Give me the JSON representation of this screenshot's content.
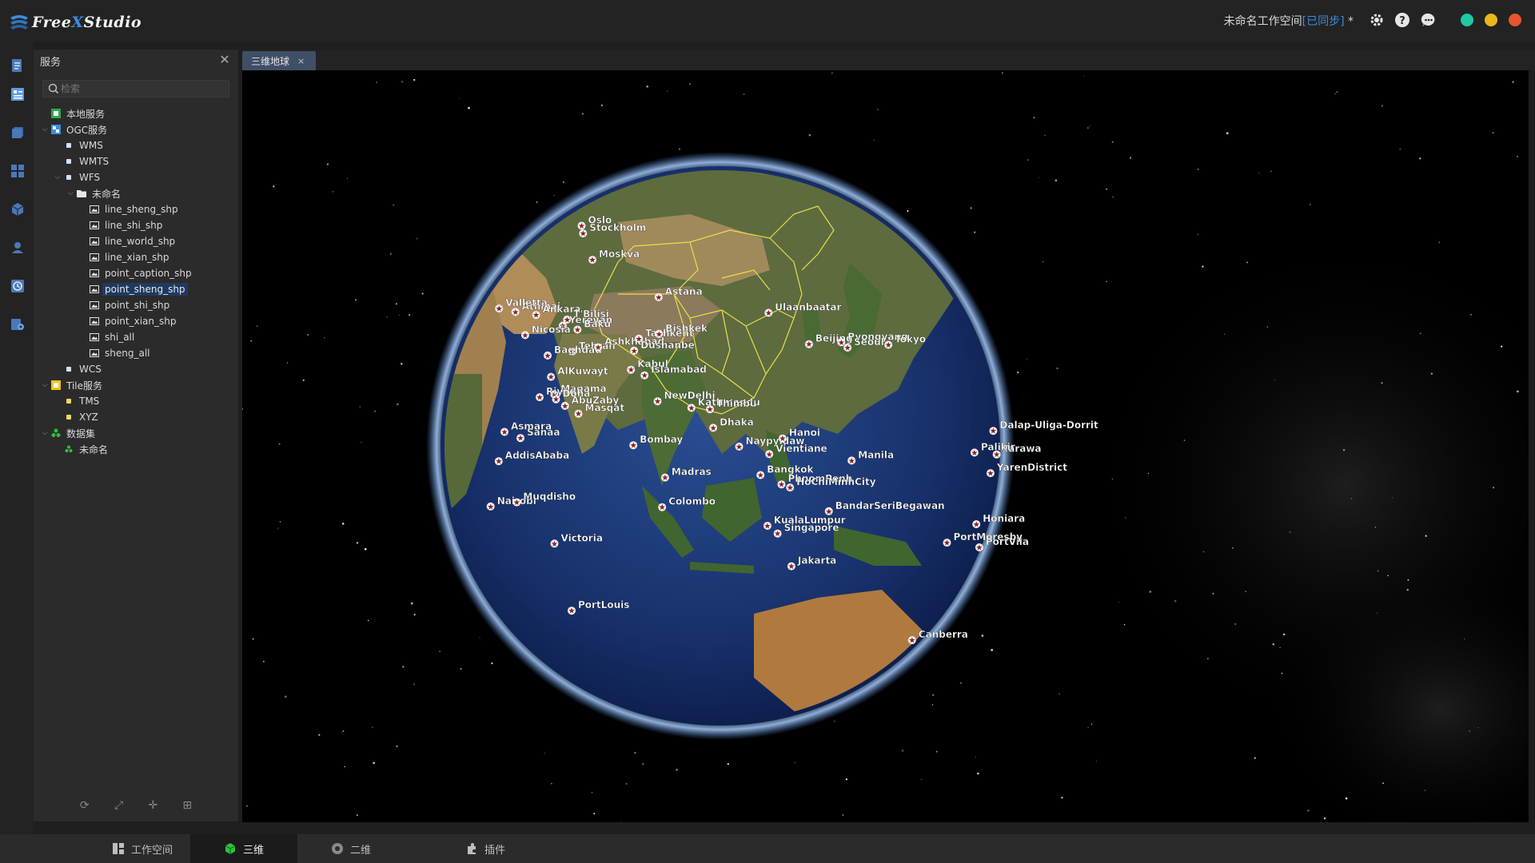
{
  "app": {
    "logo_text_1": "Free",
    "logo_text_x": "X",
    "logo_text_2": "Studio"
  },
  "header": {
    "workspace_name": "未命名工作空间",
    "sync_status": "[已同步]",
    "unsaved_mark": "*"
  },
  "panel": {
    "title": "服务",
    "search_placeholder": "检索",
    "tree": [
      {
        "label": "本地服务",
        "depth": 0,
        "caret": "",
        "icon": "local-service-icon"
      },
      {
        "label": "OGC服务",
        "depth": 0,
        "caret": "open",
        "icon": "ogc-service-icon"
      },
      {
        "label": "WMS",
        "depth": 1,
        "caret": "",
        "icon": "service-dot-icon"
      },
      {
        "label": "WMTS",
        "depth": 1,
        "caret": "",
        "icon": "service-dot-icon"
      },
      {
        "label": "WFS",
        "depth": 1,
        "caret": "open",
        "icon": "service-dot-icon"
      },
      {
        "label": "未命名",
        "depth": 2,
        "caret": "open",
        "icon": "folder-icon"
      },
      {
        "label": "line_sheng_shp",
        "depth": 3,
        "caret": "",
        "icon": "layer-icon"
      },
      {
        "label": "line_shi_shp",
        "depth": 3,
        "caret": "",
        "icon": "layer-icon"
      },
      {
        "label": "line_world_shp",
        "depth": 3,
        "caret": "",
        "icon": "layer-icon"
      },
      {
        "label": "line_xian_shp",
        "depth": 3,
        "caret": "",
        "icon": "layer-icon"
      },
      {
        "label": "point_caption_shp",
        "depth": 3,
        "caret": "",
        "icon": "layer-icon"
      },
      {
        "label": "point_sheng_shp",
        "depth": 3,
        "caret": "",
        "icon": "layer-icon",
        "selected": true
      },
      {
        "label": "point_shi_shp",
        "depth": 3,
        "caret": "",
        "icon": "layer-icon"
      },
      {
        "label": "point_xian_shp",
        "depth": 3,
        "caret": "",
        "icon": "layer-icon"
      },
      {
        "label": "shi_all",
        "depth": 3,
        "caret": "",
        "icon": "layer-icon"
      },
      {
        "label": "sheng_all",
        "depth": 3,
        "caret": "",
        "icon": "layer-icon"
      },
      {
        "label": "WCS",
        "depth": 1,
        "caret": "",
        "icon": "service-dot-icon"
      },
      {
        "label": "Tile服务",
        "depth": 0,
        "caret": "open",
        "icon": "tile-service-icon"
      },
      {
        "label": "TMS",
        "depth": 1,
        "caret": "",
        "icon": "tile-dot-icon"
      },
      {
        "label": "XYZ",
        "depth": 1,
        "caret": "",
        "icon": "tile-dot-icon"
      },
      {
        "label": "数据集",
        "depth": 0,
        "caret": "open",
        "icon": "dataset-icon"
      },
      {
        "label": "未命名",
        "depth": 1,
        "caret": "",
        "icon": "dataset-item-icon"
      }
    ]
  },
  "tabs": [
    {
      "label": "三维地球",
      "close": "×"
    }
  ],
  "bottom_tabs": [
    {
      "label": "工作空间",
      "icon": "workspace-icon"
    },
    {
      "label": "三维",
      "icon": "cube-icon",
      "active": true
    },
    {
      "label": "二维",
      "icon": "globe-2d-icon"
    },
    {
      "label": "插件",
      "icon": "plugin-icon"
    }
  ],
  "colors": {
    "accent": "#3b8de0",
    "selected_bg": "#1e3a62",
    "win_green": "#1fc9a0",
    "win_yellow": "#e8b81a",
    "win_red": "#e8542f",
    "marker": "#8b1c24"
  },
  "globe": {
    "labels": [
      {
        "text": "Oslo",
        "lon": 10.7,
        "lat": 59.9
      },
      {
        "text": "Stockholm",
        "lon": 18.1,
        "lat": 59.3
      },
      {
        "text": "Moskva",
        "lon": 37.6,
        "lat": 55.8
      },
      {
        "text": "Athinai",
        "lon": 23.7,
        "lat": 38.0
      },
      {
        "text": "Valletta",
        "lon": 14.5,
        "lat": 35.9
      },
      {
        "text": "Ankara",
        "lon": 32.9,
        "lat": 39.9
      },
      {
        "text": "T'Bilisi",
        "lon": 44.8,
        "lat": 41.7
      },
      {
        "text": "Yerevan",
        "lon": 44.5,
        "lat": 40.2
      },
      {
        "text": "Nicosia",
        "lon": 33.4,
        "lat": 35.2
      },
      {
        "text": "Baku",
        "lon": 49.9,
        "lat": 40.4
      },
      {
        "text": "Tehran",
        "lon": 51.4,
        "lat": 35.7
      },
      {
        "text": "Astana",
        "lon": 71.4,
        "lat": 51.2
      },
      {
        "text": "Baghdad",
        "lon": 44.4,
        "lat": 33.3
      },
      {
        "text": "Ashkhabad",
        "lon": 58.4,
        "lat": 37.9
      },
      {
        "text": "Tashkent",
        "lon": 69.2,
        "lat": 41.3
      },
      {
        "text": "Bishkek",
        "lon": 74.6,
        "lat": 42.9
      },
      {
        "text": "Dushanbe",
        "lon": 68.8,
        "lat": 38.6
      },
      {
        "text": "Ulaanbaatar",
        "lon": 106.9,
        "lat": 47.9
      },
      {
        "text": "AlKuwayt",
        "lon": 48.0,
        "lat": 29.4
      },
      {
        "text": "Kabul",
        "lon": 69.2,
        "lat": 34.5
      },
      {
        "text": "Manama",
        "lon": 50.6,
        "lat": 26.2
      },
      {
        "text": "Riyadh",
        "lon": 46.7,
        "lat": 24.7
      },
      {
        "text": "Doha",
        "lon": 51.5,
        "lat": 25.3
      },
      {
        "text": "Islamabad",
        "lon": 73.0,
        "lat": 33.7
      },
      {
        "text": "Beijing",
        "lon": 116.4,
        "lat": 39.9
      },
      {
        "text": "Pyongyang",
        "lon": 125.8,
        "lat": 39.0
      },
      {
        "text": "Seoul",
        "lon": 127.0,
        "lat": 37.6
      },
      {
        "text": "Tokyo",
        "lon": 139.7,
        "lat": 35.7
      },
      {
        "text": "Asmara",
        "lon": 38.9,
        "lat": 15.3
      },
      {
        "text": "AbuZaby",
        "lon": 54.4,
        "lat": 24.5
      },
      {
        "text": "Masqat",
        "lon": 58.4,
        "lat": 23.6
      },
      {
        "text": "Sanaa",
        "lon": 44.2,
        "lat": 15.4
      },
      {
        "text": "AddisAbaba",
        "lon": 38.7,
        "lat": 9.0
      },
      {
        "text": "NewDelhi",
        "lon": 77.2,
        "lat": 28.6
      },
      {
        "text": "Kathmandu",
        "lon": 85.3,
        "lat": 27.7
      },
      {
        "text": "Thimbu",
        "lon": 89.6,
        "lat": 27.5
      },
      {
        "text": "Dhaka",
        "lon": 90.4,
        "lat": 23.7
      },
      {
        "text": "Nairobi",
        "lon": 36.8,
        "lat": -1.3
      },
      {
        "text": "Muqdisho",
        "lon": 45.3,
        "lat": 2.0
      },
      {
        "text": "Bombay",
        "lon": 72.8,
        "lat": 19.1
      },
      {
        "text": "Naypyidaw",
        "lon": 96.1,
        "lat": 19.8
      },
      {
        "text": "Hanoi",
        "lon": 105.8,
        "lat": 21.0
      },
      {
        "text": "Vientiane",
        "lon": 102.6,
        "lat": 18.0
      },
      {
        "text": "Madras",
        "lon": 80.3,
        "lat": 13.1
      },
      {
        "text": "Victoria",
        "lon": 55.5,
        "lat": -4.6
      },
      {
        "text": "Colombo",
        "lon": 79.9,
        "lat": 6.9
      },
      {
        "text": "Bangkok",
        "lon": 100.5,
        "lat": 13.8
      },
      {
        "text": "PhnomPenh",
        "lon": 104.9,
        "lat": 11.6
      },
      {
        "text": "HoChiMinhCity",
        "lon": 106.7,
        "lat": 10.8
      },
      {
        "text": "Manila",
        "lon": 121.0,
        "lat": 14.6
      },
      {
        "text": "KualaLumpur",
        "lon": 101.7,
        "lat": 3.1
      },
      {
        "text": "Singapore",
        "lon": 103.8,
        "lat": 1.3
      },
      {
        "text": "BandarSeriBegawan",
        "lon": 114.9,
        "lat": 4.9
      },
      {
        "text": "PortLouis",
        "lon": 57.5,
        "lat": -20.2
      },
      {
        "text": "Jakarta",
        "lon": 106.8,
        "lat": -6.2
      },
      {
        "text": "Dalap-Uliga-Dorrit",
        "lon": 171.4,
        "lat": 7.1
      },
      {
        "text": "Tarawa",
        "lon": 173.0,
        "lat": 1.4
      },
      {
        "text": "Palikir",
        "lon": 158.2,
        "lat": 6.9
      },
      {
        "text": "YarenDistrict",
        "lon": 166.9,
        "lat": -0.5
      },
      {
        "text": "Honiara",
        "lon": 160.0,
        "lat": -9.4
      },
      {
        "text": "PortVila",
        "lon": 168.3,
        "lat": -17.7
      },
      {
        "text": "PortMoresby",
        "lon": 147.2,
        "lat": -9.4
      },
      {
        "text": "Canberra",
        "lon": 149.1,
        "lat": -35.3
      }
    ]
  }
}
